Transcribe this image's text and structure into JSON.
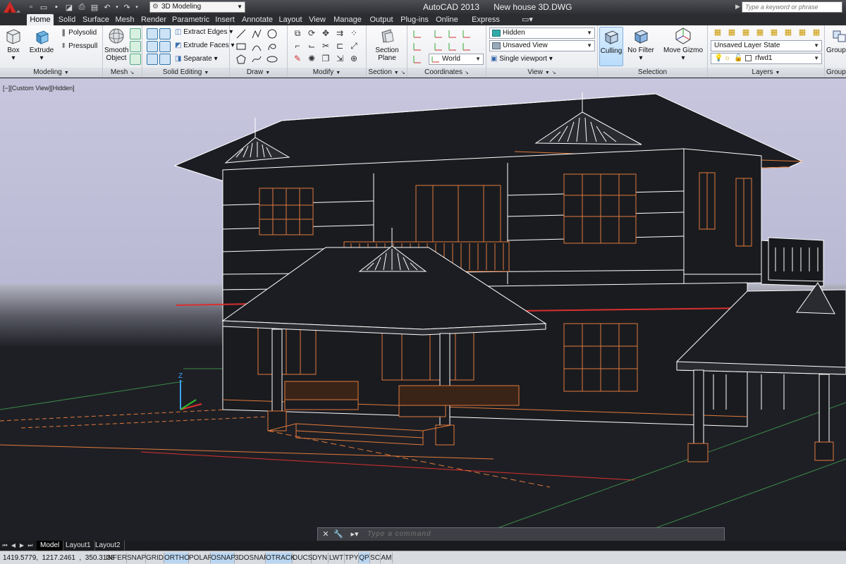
{
  "window": {
    "app_title": "AutoCAD 2013",
    "document": "New house 3D.DWG",
    "workspace": "3D Modeling",
    "search_placeholder": "Type a keyword or phrase"
  },
  "colors": {
    "titlebar": "#3b3c41",
    "ribbon": "#eceef1",
    "sky": "#c7c7dc",
    "ground": "#1e1f24",
    "model_edges": "#ffffff",
    "model_orange": "#e07a3c",
    "model_red": "#d83030"
  },
  "tabs": [
    {
      "label": "Home",
      "active": true
    },
    {
      "label": "Solid"
    },
    {
      "label": "Surface"
    },
    {
      "label": "Mesh"
    },
    {
      "label": "Render"
    },
    {
      "label": "Parametric"
    },
    {
      "label": "Insert"
    },
    {
      "label": "Annotate"
    },
    {
      "label": "Layout"
    },
    {
      "label": "View"
    },
    {
      "label": "Manage"
    },
    {
      "label": "Output"
    },
    {
      "label": "Plug-ins"
    },
    {
      "label": "Online"
    },
    {
      "label": "Express Tools"
    }
  ],
  "ribbon": {
    "modeling": {
      "label": "Modeling",
      "box": "Box",
      "extrude": "Extrude",
      "polysolid": "Polysolid",
      "presspull": "Presspull"
    },
    "mesh": {
      "label": "Mesh",
      "smooth_object": "Smooth Object"
    },
    "solid_editing": {
      "label": "Solid Editing",
      "extract_edges": "Extract Edges",
      "extrude_faces": "Extrude Faces",
      "separate": "Separate"
    },
    "draw": {
      "label": "Draw"
    },
    "modify": {
      "label": "Modify"
    },
    "section": {
      "label": "Section",
      "section_plane": "Section Plane"
    },
    "coordinates": {
      "label": "Coordinates",
      "ucs": "World"
    },
    "view": {
      "label": "View",
      "visual_style": "Hidden",
      "saved_view": "Unsaved View",
      "viewport": "Single viewport"
    },
    "selection": {
      "label": "Selection",
      "culling": "Culling",
      "no_filter": "No Filter",
      "move_gizmo": "Move Gizmo"
    },
    "layers": {
      "label": "Layers",
      "layer_state": "Unsaved Layer State",
      "current_layer": "rfwd1"
    },
    "groups": {
      "label": "Groups",
      "group": "Group"
    }
  },
  "viewport": {
    "controls": "[−][Custom View][Hidden]"
  },
  "command": {
    "placeholder": "Type a command"
  },
  "layout_tabs": [
    {
      "label": "Model",
      "active": true
    },
    {
      "label": "Layout1"
    },
    {
      "label": "Layout2"
    }
  ],
  "status": {
    "coords": "1419.5779,  1217.2461  ,  350.3138",
    "toggles": [
      {
        "label": "INFER",
        "on": false
      },
      {
        "label": "SNAP",
        "on": false
      },
      {
        "label": "GRID",
        "on": false
      },
      {
        "label": "ORTHO",
        "on": true
      },
      {
        "label": "POLAR",
        "on": false
      },
      {
        "label": "OSNAP",
        "on": true
      },
      {
        "label": "3DOSNAP",
        "on": false
      },
      {
        "label": "OTRACK",
        "on": true
      },
      {
        "label": "DUCS",
        "on": false
      },
      {
        "label": "DYN",
        "on": false
      },
      {
        "label": "LWT",
        "on": false
      },
      {
        "label": "TPY",
        "on": false
      },
      {
        "label": "QP",
        "on": true
      },
      {
        "label": "SC",
        "on": false
      },
      {
        "label": "AM",
        "on": false
      }
    ]
  }
}
